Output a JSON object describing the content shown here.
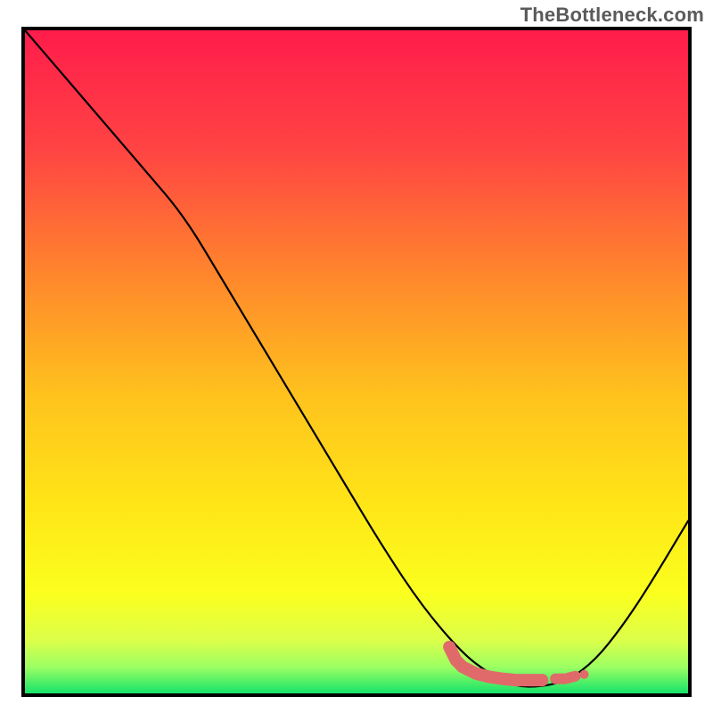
{
  "watermark": "TheBottleneck.com",
  "chart_data": {
    "type": "line",
    "title": "",
    "xlabel": "",
    "ylabel": "",
    "xlim": [
      0,
      100
    ],
    "ylim": [
      0,
      100
    ],
    "grid": false,
    "legend": false,
    "gradient_stops": [
      {
        "offset": 0.0,
        "color": "#ff1c4b"
      },
      {
        "offset": 0.18,
        "color": "#ff4443"
      },
      {
        "offset": 0.38,
        "color": "#ff8a2b"
      },
      {
        "offset": 0.55,
        "color": "#ffc21e"
      },
      {
        "offset": 0.72,
        "color": "#ffe617"
      },
      {
        "offset": 0.85,
        "color": "#fbff1e"
      },
      {
        "offset": 0.92,
        "color": "#dcff4a"
      },
      {
        "offset": 0.96,
        "color": "#9cff62"
      },
      {
        "offset": 1.0,
        "color": "#17e36a"
      }
    ],
    "series": [
      {
        "name": "bottleneck-curve",
        "x": [
          0,
          6,
          12,
          18,
          24,
          30,
          36,
          42,
          48,
          54,
          60,
          66,
          70,
          74,
          78,
          82,
          86,
          90,
          94,
          100
        ],
        "y": [
          100,
          93,
          86,
          79,
          72,
          62,
          52,
          42,
          32,
          22,
          13,
          6,
          3,
          1,
          1,
          2,
          5,
          10,
          16,
          26
        ]
      }
    ],
    "markers": {
      "name": "optimal-band",
      "color": "#e06a6a",
      "points": [
        {
          "x": 64,
          "y": 7
        },
        {
          "x": 65,
          "y": 5
        },
        {
          "x": 66,
          "y": 4
        },
        {
          "x": 68,
          "y": 3
        },
        {
          "x": 70,
          "y": 2.5
        },
        {
          "x": 72,
          "y": 2.2
        },
        {
          "x": 74,
          "y": 2
        },
        {
          "x": 76,
          "y": 2
        },
        {
          "x": 78,
          "y": 2
        },
        {
          "x": 80,
          "y": 2.2
        },
        {
          "x": 81.5,
          "y": 2.2
        },
        {
          "x": 83,
          "y": 2.6
        }
      ]
    },
    "curve_stroke": "#000000",
    "curve_width": 2.2
  }
}
